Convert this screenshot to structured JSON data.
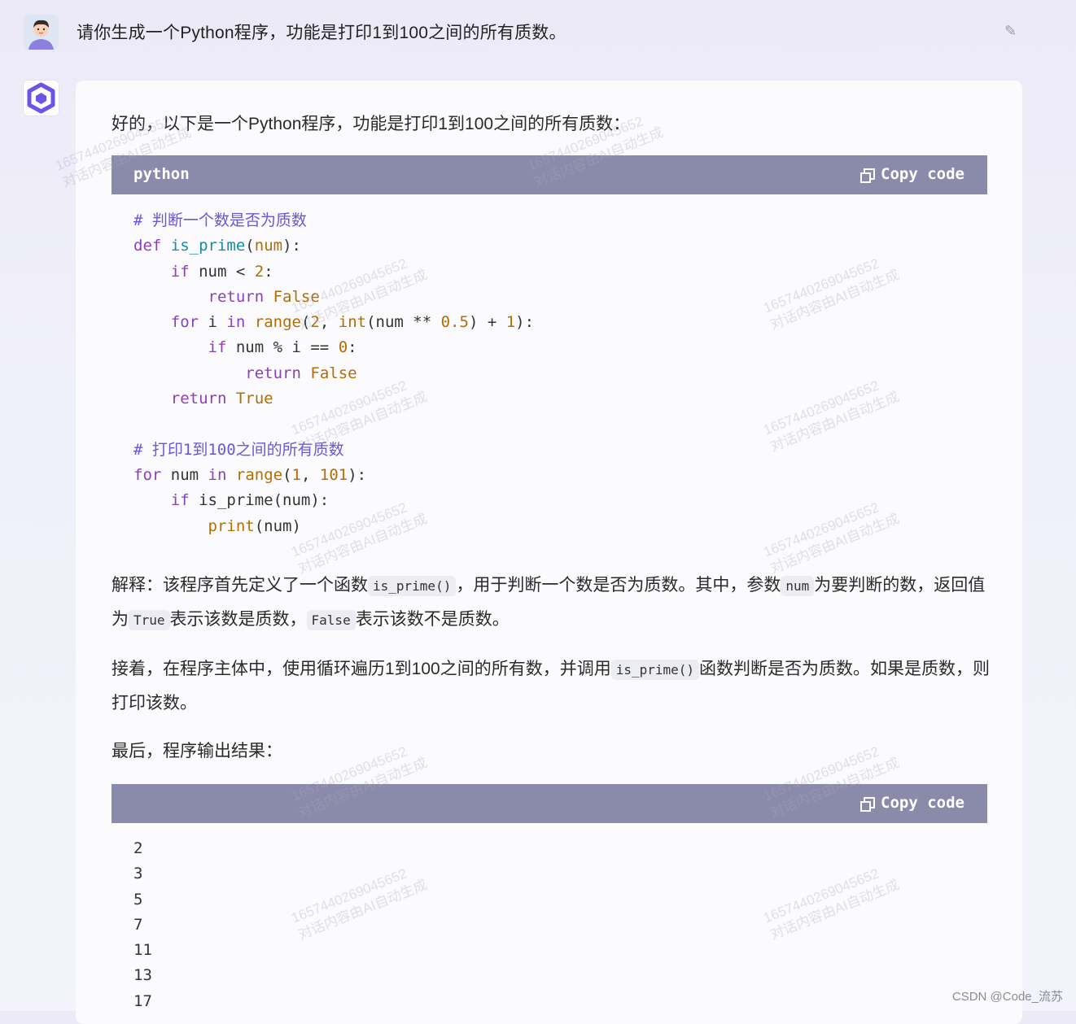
{
  "user_message": "请你生成一个Python程序，功能是打印1到100之间的所有质数。",
  "assistant": {
    "intro": "好的，以下是一个Python程序，功能是打印1到100之间的所有质数：",
    "code_block_1": {
      "language": "python",
      "copy_label": "Copy code"
    },
    "explanation": {
      "p1_a": "解释：该程序首先定义了一个函数",
      "p1_code1": "is_prime()",
      "p1_b": "，用于判断一个数是否为质数。其中，参数",
      "p1_code2": "num",
      "p1_c": "为要判断的数，返回值为",
      "p1_code3": "True",
      "p1_d": "表示该数是质数，",
      "p1_code4": "False",
      "p1_e": "表示该数不是质数。",
      "p2_a": "接着，在程序主体中，使用循环遍历1到100之间的所有数，并调用",
      "p2_code": "is_prime()",
      "p2_b": "函数判断是否为质数。如果是质数，则打印该数。",
      "p3": "最后，程序输出结果："
    },
    "code_block_2": {
      "copy_label": "Copy code",
      "output": [
        "2",
        "3",
        "5",
        "7",
        "11",
        "13",
        "17"
      ]
    }
  },
  "watermark": {
    "line1": "1657440269045652",
    "line2": "对话内容由AI自动生成"
  },
  "footer": "CSDN @Code_流苏"
}
